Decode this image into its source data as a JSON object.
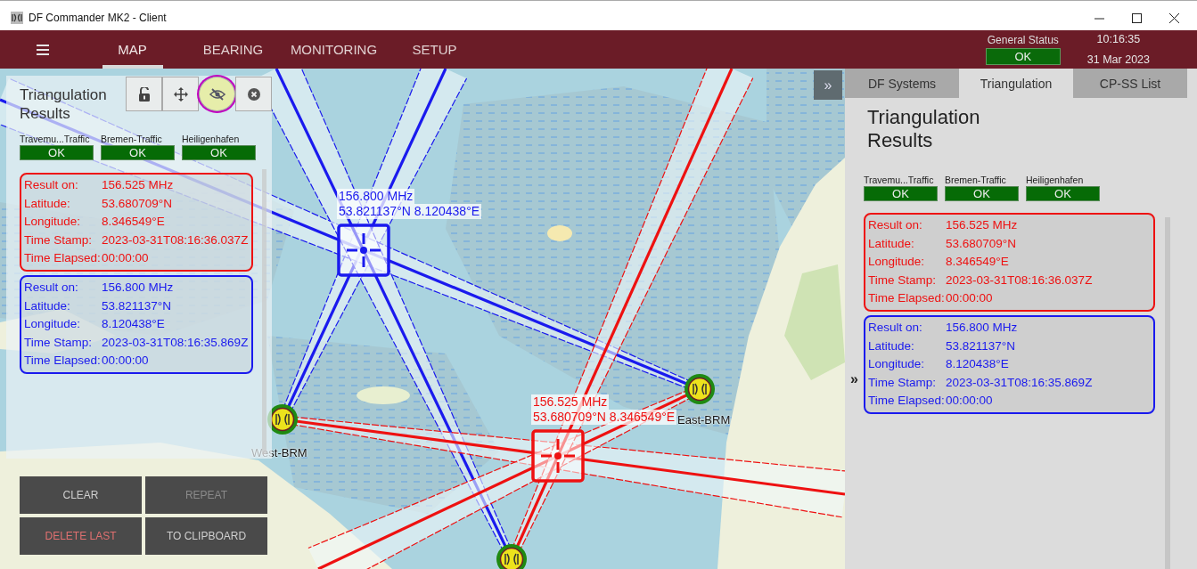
{
  "window": {
    "title": "DF Commander MK2 - Client"
  },
  "header": {
    "tabs": [
      {
        "label": "MAP",
        "selected": true
      },
      {
        "label": "BEARING",
        "selected": false
      },
      {
        "label": "MONITORING",
        "selected": false
      },
      {
        "label": "SETUP",
        "selected": false
      }
    ],
    "general_status": {
      "label": "General Status",
      "value": "OK"
    },
    "clock": {
      "time": "10:16:35",
      "date": "31 Mar 2023"
    }
  },
  "map": {
    "collapse_button": "»",
    "target_labels": [
      {
        "frequency": "156.800 MHz",
        "position": "53.821137°N 8.120438°E",
        "color": "#1a1aee"
      },
      {
        "frequency": "156.525 MHz",
        "position": "53.680709°N 8.346549°E",
        "color": "#ee1111"
      }
    ],
    "stations": [
      {
        "name": "West-BRM"
      },
      {
        "name": "East-BRM"
      }
    ],
    "results_panel": {
      "title": "Triangulation Results",
      "toolbar": [
        {
          "kind": "lock",
          "hovered": false
        },
        {
          "kind": "move",
          "hovered": false
        },
        {
          "kind": "hide",
          "hovered": true
        },
        {
          "kind": "close",
          "hovered": false
        }
      ],
      "systems": [
        {
          "name": "Travemu...Traffic",
          "status": "OK"
        },
        {
          "name": "Bremen-Traffic",
          "status": "OK"
        },
        {
          "name": "Heiligenhafen",
          "status": "OK"
        }
      ],
      "results": [
        {
          "color": "#ee1111",
          "fields": [
            {
              "label": "Result on:",
              "value": "156.525 MHz"
            },
            {
              "label": "Latitude:",
              "value": "53.680709°N"
            },
            {
              "label": "Longitude:",
              "value": "8.346549°E"
            },
            {
              "label": "Time Stamp:",
              "value": "2023-03-31T08:16:36.037Z"
            },
            {
              "label": "Time Elapsed:",
              "value": "00:00:00"
            }
          ]
        },
        {
          "color": "#1a1aee",
          "fields": [
            {
              "label": "Result on:",
              "value": "156.800 MHz"
            },
            {
              "label": "Latitude:",
              "value": "53.821137°N"
            },
            {
              "label": "Longitude:",
              "value": "8.120438°E"
            },
            {
              "label": "Time Stamp:",
              "value": "2023-03-31T08:16:35.869Z"
            },
            {
              "label": "Time Elapsed:",
              "value": "00:00:00"
            }
          ]
        }
      ]
    },
    "actions": [
      {
        "label": "CLEAR",
        "kind": "normal",
        "disabled": false
      },
      {
        "label": "REPEAT",
        "kind": "normal",
        "disabled": true
      },
      {
        "label": "DELETE LAST",
        "kind": "danger",
        "disabled": false
      },
      {
        "label": "TO CLIPBOARD",
        "kind": "normal",
        "disabled": false
      }
    ]
  },
  "side_panel": {
    "tabs": [
      {
        "label": "DF Systems",
        "selected": false
      },
      {
        "label": "Triangulation",
        "selected": true
      },
      {
        "label": "CP-SS List",
        "selected": false
      }
    ],
    "title": "Triangulation Results",
    "systems": [
      {
        "name": "Travemu...Traffic",
        "status": "OK"
      },
      {
        "name": "Bremen-Traffic",
        "status": "OK"
      },
      {
        "name": "Heiligenhafen",
        "status": "OK"
      }
    ],
    "results": [
      {
        "color": "#ee1111",
        "fields": [
          {
            "label": "Result on:",
            "value": "156.525 MHz"
          },
          {
            "label": "Latitude:",
            "value": "53.680709°N"
          },
          {
            "label": "Longitude:",
            "value": "8.346549°E"
          },
          {
            "label": "Time Stamp:",
            "value": "2023-03-31T08:16:36.037Z"
          },
          {
            "label": "Time Elapsed:",
            "value": "00:00:00"
          }
        ]
      },
      {
        "color": "#1a1aee",
        "fields": [
          {
            "label": "Result on:",
            "value": "156.800 MHz"
          },
          {
            "label": "Latitude:",
            "value": "53.821137°N"
          },
          {
            "label": "Longitude:",
            "value": "8.120438°E"
          },
          {
            "label": "Time Stamp:",
            "value": "2023-03-31T08:16:35.869Z"
          },
          {
            "label": "Time Elapsed:",
            "value": "00:00:00"
          }
        ]
      }
    ],
    "expand_button": "»"
  }
}
